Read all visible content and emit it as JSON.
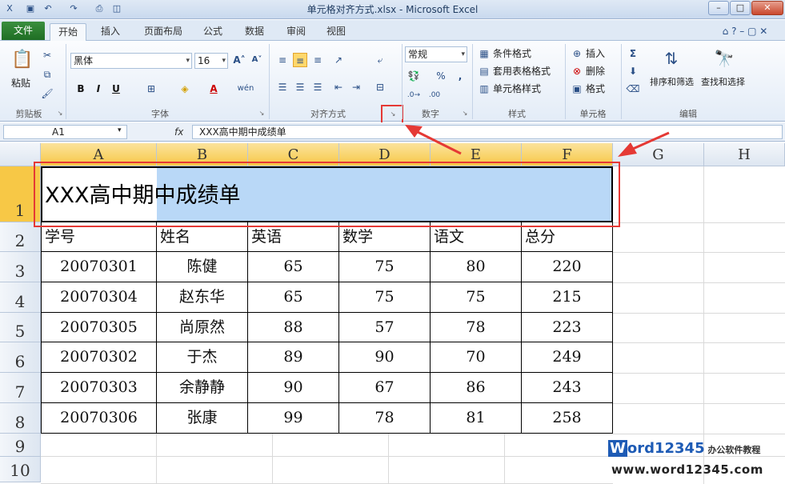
{
  "window": {
    "title": "单元格对齐方式.xlsx - Microsoft Excel",
    "controls": [
      "–",
      "□",
      "✕"
    ]
  },
  "quick_access": {
    "icons": [
      "excel-icon",
      "save-icon",
      "undo-icon",
      "redo-icon",
      "print-icon",
      "print-preview-icon"
    ]
  },
  "ribbon": {
    "file_tab": "文件",
    "tabs": [
      "开始",
      "插入",
      "页面布局",
      "公式",
      "数据",
      "审阅",
      "视图"
    ],
    "groups": {
      "clipboard": {
        "label": "剪贴板",
        "paste": "粘贴"
      },
      "font": {
        "label": "字体",
        "font_name": "黑体",
        "font_size": "16",
        "bold": "B",
        "italic": "I",
        "underline": "U",
        "phonetic": "wén"
      },
      "alignment": {
        "label": "对齐方式"
      },
      "number": {
        "label": "数字",
        "format": "常规",
        "percent": "%",
        "comma": ","
      },
      "styles": {
        "label": "样式",
        "items": [
          "条件格式",
          "套用表格格式",
          "单元格样式"
        ]
      },
      "cells": {
        "label": "单元格",
        "items": [
          "插入",
          "删除",
          "格式"
        ]
      },
      "editing": {
        "label": "编辑",
        "sort_filter": "排序和筛选",
        "find_select": "查找和选择",
        "sum": "Σ"
      }
    }
  },
  "formula_bar": {
    "name_box": "A1",
    "fx": "fx",
    "formula": "XXX高中期中成绩单"
  },
  "sheet": {
    "columns": [
      "A",
      "B",
      "C",
      "D",
      "E",
      "F",
      "G",
      "H"
    ],
    "rows": [
      "1",
      "2",
      "3",
      "4",
      "5",
      "6",
      "7",
      "8",
      "9",
      "10"
    ],
    "title": "XXX高中期中成绩单",
    "headers": [
      "学号",
      "姓名",
      "英语",
      "数学",
      "语文",
      "总分"
    ],
    "data": [
      [
        "20070301",
        "陈健",
        "65",
        "75",
        "80",
        "220"
      ],
      [
        "20070304",
        "赵东华",
        "65",
        "75",
        "75",
        "215"
      ],
      [
        "20070305",
        "尚原然",
        "88",
        "57",
        "78",
        "223"
      ],
      [
        "20070302",
        "于杰",
        "89",
        "90",
        "70",
        "249"
      ],
      [
        "20070303",
        "余静静",
        "90",
        "67",
        "86",
        "243"
      ],
      [
        "20070306",
        "张康",
        "99",
        "78",
        "81",
        "258"
      ]
    ]
  },
  "watermark": {
    "brand": "Word12345",
    "tagline": "办公软件教程",
    "url": "www.word12345.com"
  },
  "colors": {
    "highlight": "#e53935",
    "selection": "#b9d8f7",
    "header_selected": "#f7c846",
    "file_tab": "#2a7d2e"
  }
}
